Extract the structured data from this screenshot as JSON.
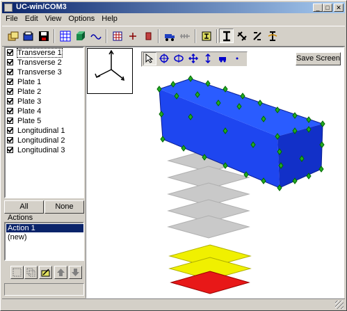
{
  "window": {
    "title": "UC-win/COM3"
  },
  "menu": [
    "File",
    "Edit",
    "View",
    "Options",
    "Help"
  ],
  "layers": [
    {
      "label": "Transverse 1",
      "checked": true,
      "selected": true
    },
    {
      "label": "Transverse 2",
      "checked": true
    },
    {
      "label": "Transverse 3",
      "checked": true
    },
    {
      "label": "Plate 1",
      "checked": true
    },
    {
      "label": "Plate 2",
      "checked": true
    },
    {
      "label": "Plate 3",
      "checked": true
    },
    {
      "label": "Plate 4",
      "checked": true
    },
    {
      "label": "Plate 5",
      "checked": true
    },
    {
      "label": "Longitudinal 1",
      "checked": true
    },
    {
      "label": "Longitudinal 2",
      "checked": true
    },
    {
      "label": "Longitudinal 3",
      "checked": true
    }
  ],
  "layer_buttons": {
    "all": "All",
    "none": "None"
  },
  "actions": {
    "label": "Actions",
    "items": [
      {
        "label": "Action 1",
        "selected": true
      },
      {
        "label": "(new)"
      }
    ]
  },
  "viewport": {
    "save_screen": "Save Screen",
    "colors": {
      "box": "#1e46f0",
      "nodes": "#22aa22",
      "layer_gray": "#c9c9c9",
      "layer_yellow": "#f0f000",
      "layer_red": "#e81818"
    }
  }
}
